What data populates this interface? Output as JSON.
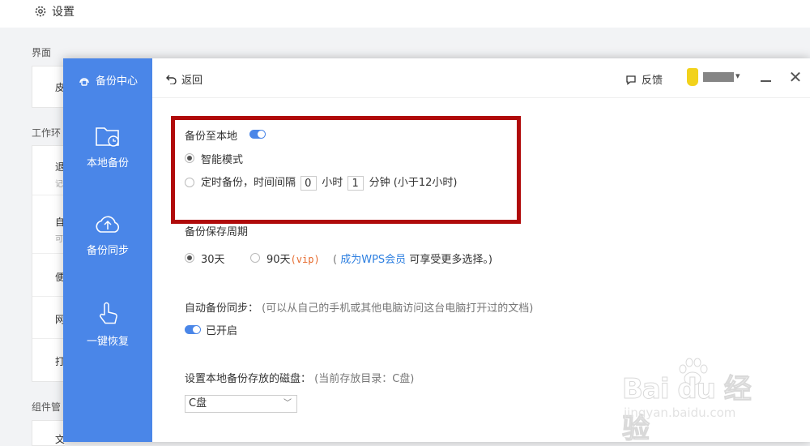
{
  "background": {
    "title": "设置",
    "section_interface": "界面",
    "section_workspace": "工作环",
    "section_components": "组件管",
    "item_peek_1": "皮",
    "item_peek_2": "退",
    "item_peek_2_sub": "记",
    "item_peek_3": "自",
    "item_peek_3_sub": "可",
    "item_peek_4": "便",
    "item_peek_5": "网",
    "item_peek_6": "打",
    "item_peek_7": "文"
  },
  "sidebar": {
    "title": "备份中心",
    "items": [
      {
        "label": "本地备份",
        "icon": "folder-clock-icon"
      },
      {
        "label": "备份同步",
        "icon": "cloud-upload-icon"
      },
      {
        "label": "一键恢复",
        "icon": "hand-pointer-icon"
      }
    ]
  },
  "topbar": {
    "back_label": "返回",
    "feedback_label": "反馈"
  },
  "local_backup": {
    "label": "备份至本地",
    "enabled": true,
    "smart_mode_label": "智能模式",
    "timed_prefix": "定时备份，时间间隔",
    "hours_value": "0",
    "hours_unit": "小时",
    "minutes_value": "1",
    "minutes_unit": "分钟",
    "timed_suffix": "(小于12小时)",
    "selected_mode": "smart"
  },
  "retention": {
    "label": "备份保存周期",
    "option_30": "30天",
    "option_90": "90天",
    "option_90_tag": "(vip)",
    "paren_open": "(",
    "member_link": "成为WPS会员",
    "member_suffix": "可享受更多选择。)",
    "selected": "30天"
  },
  "auto_sync": {
    "label": "自动备份同步：",
    "hint": "(可以从自己的手机或其他电脑访问这台电脑打开过的文档)",
    "status": "已开启",
    "enabled": true
  },
  "disk": {
    "label": "设置本地备份存放的磁盘：",
    "hint": "(当前存放目录：C盘)",
    "selected": "C盘"
  },
  "colors": {
    "sidebar": "#4a86e8",
    "highlight_border": "#b00a0a",
    "link": "#2d7fe0",
    "vip": "#e66a2c"
  }
}
